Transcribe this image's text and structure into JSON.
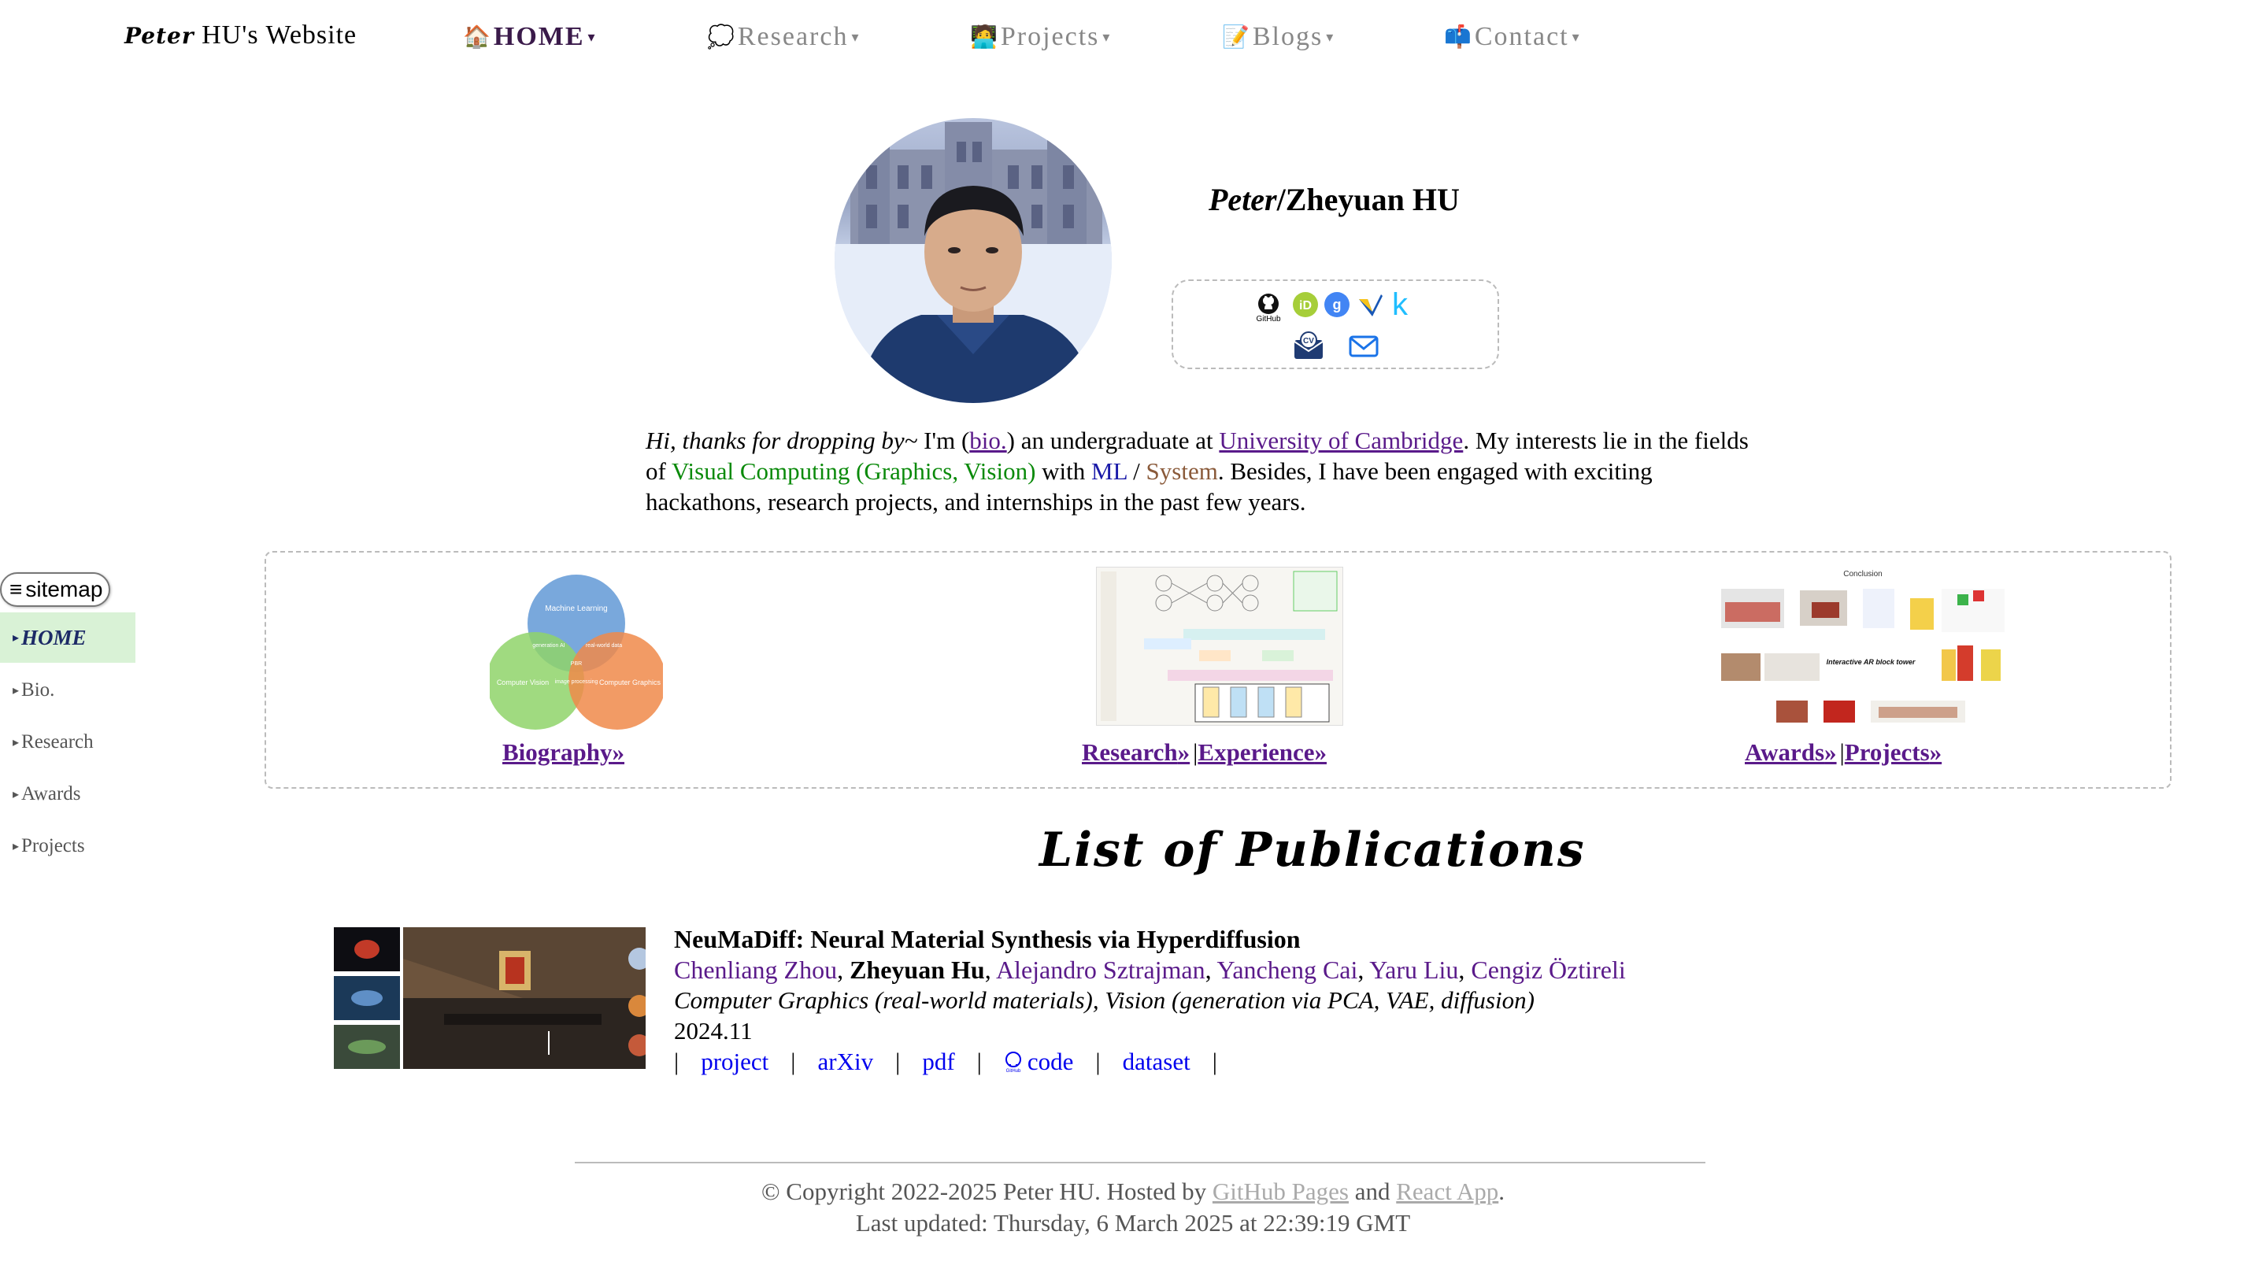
{
  "header": {
    "site_title_cursive": "Peter",
    "site_title_rest": " HU's Website",
    "nav": [
      {
        "icon": "🏠",
        "label": "HOME",
        "active": true
      },
      {
        "icon": "💭",
        "label": "Research"
      },
      {
        "icon": "🧑‍💻",
        "label": "Projects"
      },
      {
        "icon": "📝",
        "label": "Blogs"
      },
      {
        "icon": "📫",
        "label": "Contact"
      }
    ],
    "caret": "▾"
  },
  "sidebar": {
    "toggle_label": "sitemap",
    "toggle_icon": "≡",
    "items": [
      {
        "label": "HOME",
        "active": true
      },
      {
        "label": "Bio."
      },
      {
        "label": "Research"
      },
      {
        "label": "Awards"
      },
      {
        "label": "Projects"
      }
    ]
  },
  "profile": {
    "name_italic": "Peter",
    "name_rest": "/Zheyuan HU",
    "links": [
      "github-icon",
      "orcid-icon",
      "google-scholar-icon",
      "semantic-scholar-icon",
      "kaggle-icon",
      "cv-icon",
      "email-icon"
    ],
    "github_caption": "GitHub",
    "cv_caption": "CV"
  },
  "intro": {
    "greeting": "Hi, thanks for dropping by~",
    "p1": " I'm (",
    "bio_link": "bio.",
    "p2": ") an undergraduate at ",
    "uni_link": "University of Cambridge",
    "p3": ". My interests lie in the fields of ",
    "visual": "Visual Computing (Graphics, Vision)",
    "p4": " with ",
    "ml": "ML",
    "p5": " / ",
    "system": "System",
    "p6": ". Besides, I have been engaged with exciting hackathons, research projects, and internships in the past few years."
  },
  "gallery": {
    "venn": {
      "ml": "Machine Learning",
      "cv": "Computer Vision",
      "cg": "Computer Graphics",
      "gen_ai": "generation AI",
      "real_data": "real-world data",
      "core": "PBR",
      "img_proc": "image processing"
    },
    "bio_link": "Biography",
    "research_link": "Research",
    "experience_link": "Experience",
    "awards_link": "Awards",
    "projects_link": "Projects",
    "arrow": "»",
    "bar": "|",
    "conclusion_title": "Conclusion",
    "conclusion_caption": "Interactive AR block tower"
  },
  "publications": {
    "heading": "List of Publications",
    "items": [
      {
        "title": "NeuMaDiff: Neural Material Synthesis via Hyperdiffusion",
        "authors": [
          "Chenliang Zhou",
          "Zheyuan Hu",
          "Alejandro Sztrajman",
          "Yancheng Cai",
          "Yaru Liu",
          "Cengiz Öztireli"
        ],
        "topics": "Computer Graphics (real-world materials), Vision (generation via PCA, VAE, diffusion)",
        "date": "2024.11",
        "links": [
          "project",
          "arXiv",
          "pdf",
          "code",
          "dataset"
        ]
      }
    ]
  },
  "footer": {
    "copy_pre": "© Copyright 2022-2025 Peter HU. Hosted by ",
    "github_pages": "GitHub Pages",
    "and": " and ",
    "react_app": "React App",
    "dot": ".",
    "updated": "Last updated: Thursday, 6 March 2025 at 22:39:19 GMT"
  }
}
